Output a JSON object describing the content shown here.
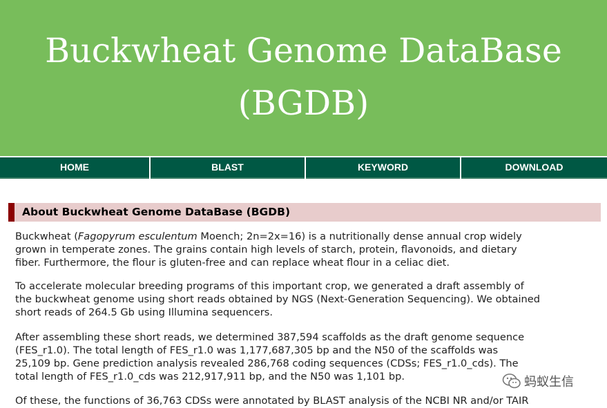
{
  "header": {
    "title_line1": "Buckwheat Genome DataBase",
    "title_line2": "(BGDB)",
    "background_color": "#78bd5b"
  },
  "nav": {
    "items": [
      {
        "label": "HOME"
      },
      {
        "label": "BLAST"
      },
      {
        "label": "KEYWORD"
      },
      {
        "label": "DOWNLOAD"
      }
    ],
    "background_color": "#005844"
  },
  "section": {
    "title": "About Buckwheat Genome DataBase (BGDB)",
    "background_color": "#e8cccc",
    "accent_color": "#8b0000"
  },
  "paragraphs": {
    "p1": {
      "l1_pre": "Buckwheat (",
      "l1_italic": "Fagopyrum esculentum",
      "l1_post": " Moench; 2n=2x=16) is a nutritionally dense annual crop widely",
      "l2": "grown in temperate zones. The grains contain high levels of starch, protein, flavonoids, and dietary",
      "l3": "fiber. Furthermore, the flour is gluten-free and can replace wheat flour in a celiac diet."
    },
    "p2": {
      "l1": "To accelerate molecular breeding programs of this important crop, we generated a draft assembly of",
      "l2": "the buckwheat genome using short reads obtained by NGS (Next-Generation Sequencing). We obtained",
      "l3": "short reads of 264.5 Gb using Illumina sequencers."
    },
    "p3": {
      "l1": "After assembling these short reads, we determined 387,594 scaffolds as the draft genome sequence",
      "l2": "(FES_r1.0). The total length of FES_r1.0 was 1,177,687,305 bp and the N50 of the scaffolds was",
      "l3": "25,109 bp. Gene prediction analysis revealed 286,768 coding sequences (CDSs; FES_r1.0_cds). The",
      "l4": "total length of FES_r1.0_cds was 212,917,911 bp, and the N50 was 1,101 bp."
    },
    "p4": {
      "l1": "Of these, the functions of 36,763 CDSs were annotated by BLAST analysis of the NCBI NR and/or TAIR"
    }
  },
  "watermark": {
    "icon": "wechat-icon",
    "text": "蚂蚁生信"
  }
}
